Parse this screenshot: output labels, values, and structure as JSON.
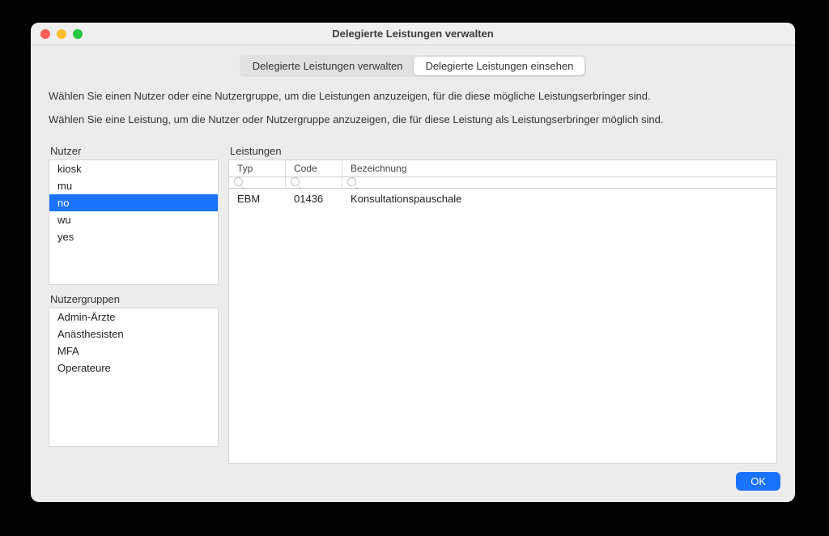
{
  "window": {
    "title": "Delegierte Leistungen verwalten"
  },
  "tabs": [
    {
      "label": "Delegierte Leistungen verwalten",
      "active": false
    },
    {
      "label": "Delegierte Leistungen einsehen",
      "active": true
    }
  ],
  "instructions": {
    "line1": "Wählen Sie einen Nutzer oder eine Nutzergruppe, um die Leistungen anzuzeigen, für die diese mögliche Leistungserbringer sind.",
    "line2": "Wählen Sie eine Leistung, um die Nutzer oder Nutzergruppe anzuzeigen, die für diese Leistung als Leistungserbringer möglich sind."
  },
  "labels": {
    "users": "Nutzer",
    "groups": "Nutzergruppen",
    "services": "Leistungen"
  },
  "users": [
    {
      "name": "kiosk",
      "selected": false
    },
    {
      "name": "mu",
      "selected": false
    },
    {
      "name": "no",
      "selected": true
    },
    {
      "name": "wu",
      "selected": false
    },
    {
      "name": "yes",
      "selected": false
    }
  ],
  "groups": [
    {
      "name": "Admin-Ärzte"
    },
    {
      "name": "Anästhesisten"
    },
    {
      "name": "MFA"
    },
    {
      "name": "Operateure"
    }
  ],
  "table": {
    "headers": {
      "typ": "Typ",
      "code": "Code",
      "bezeichnung": "Bezeichnung"
    },
    "rows": [
      {
        "typ": "EBM",
        "code": "01436",
        "bezeichnung": "Konsultationspauschale"
      }
    ]
  },
  "buttons": {
    "ok": "OK"
  }
}
